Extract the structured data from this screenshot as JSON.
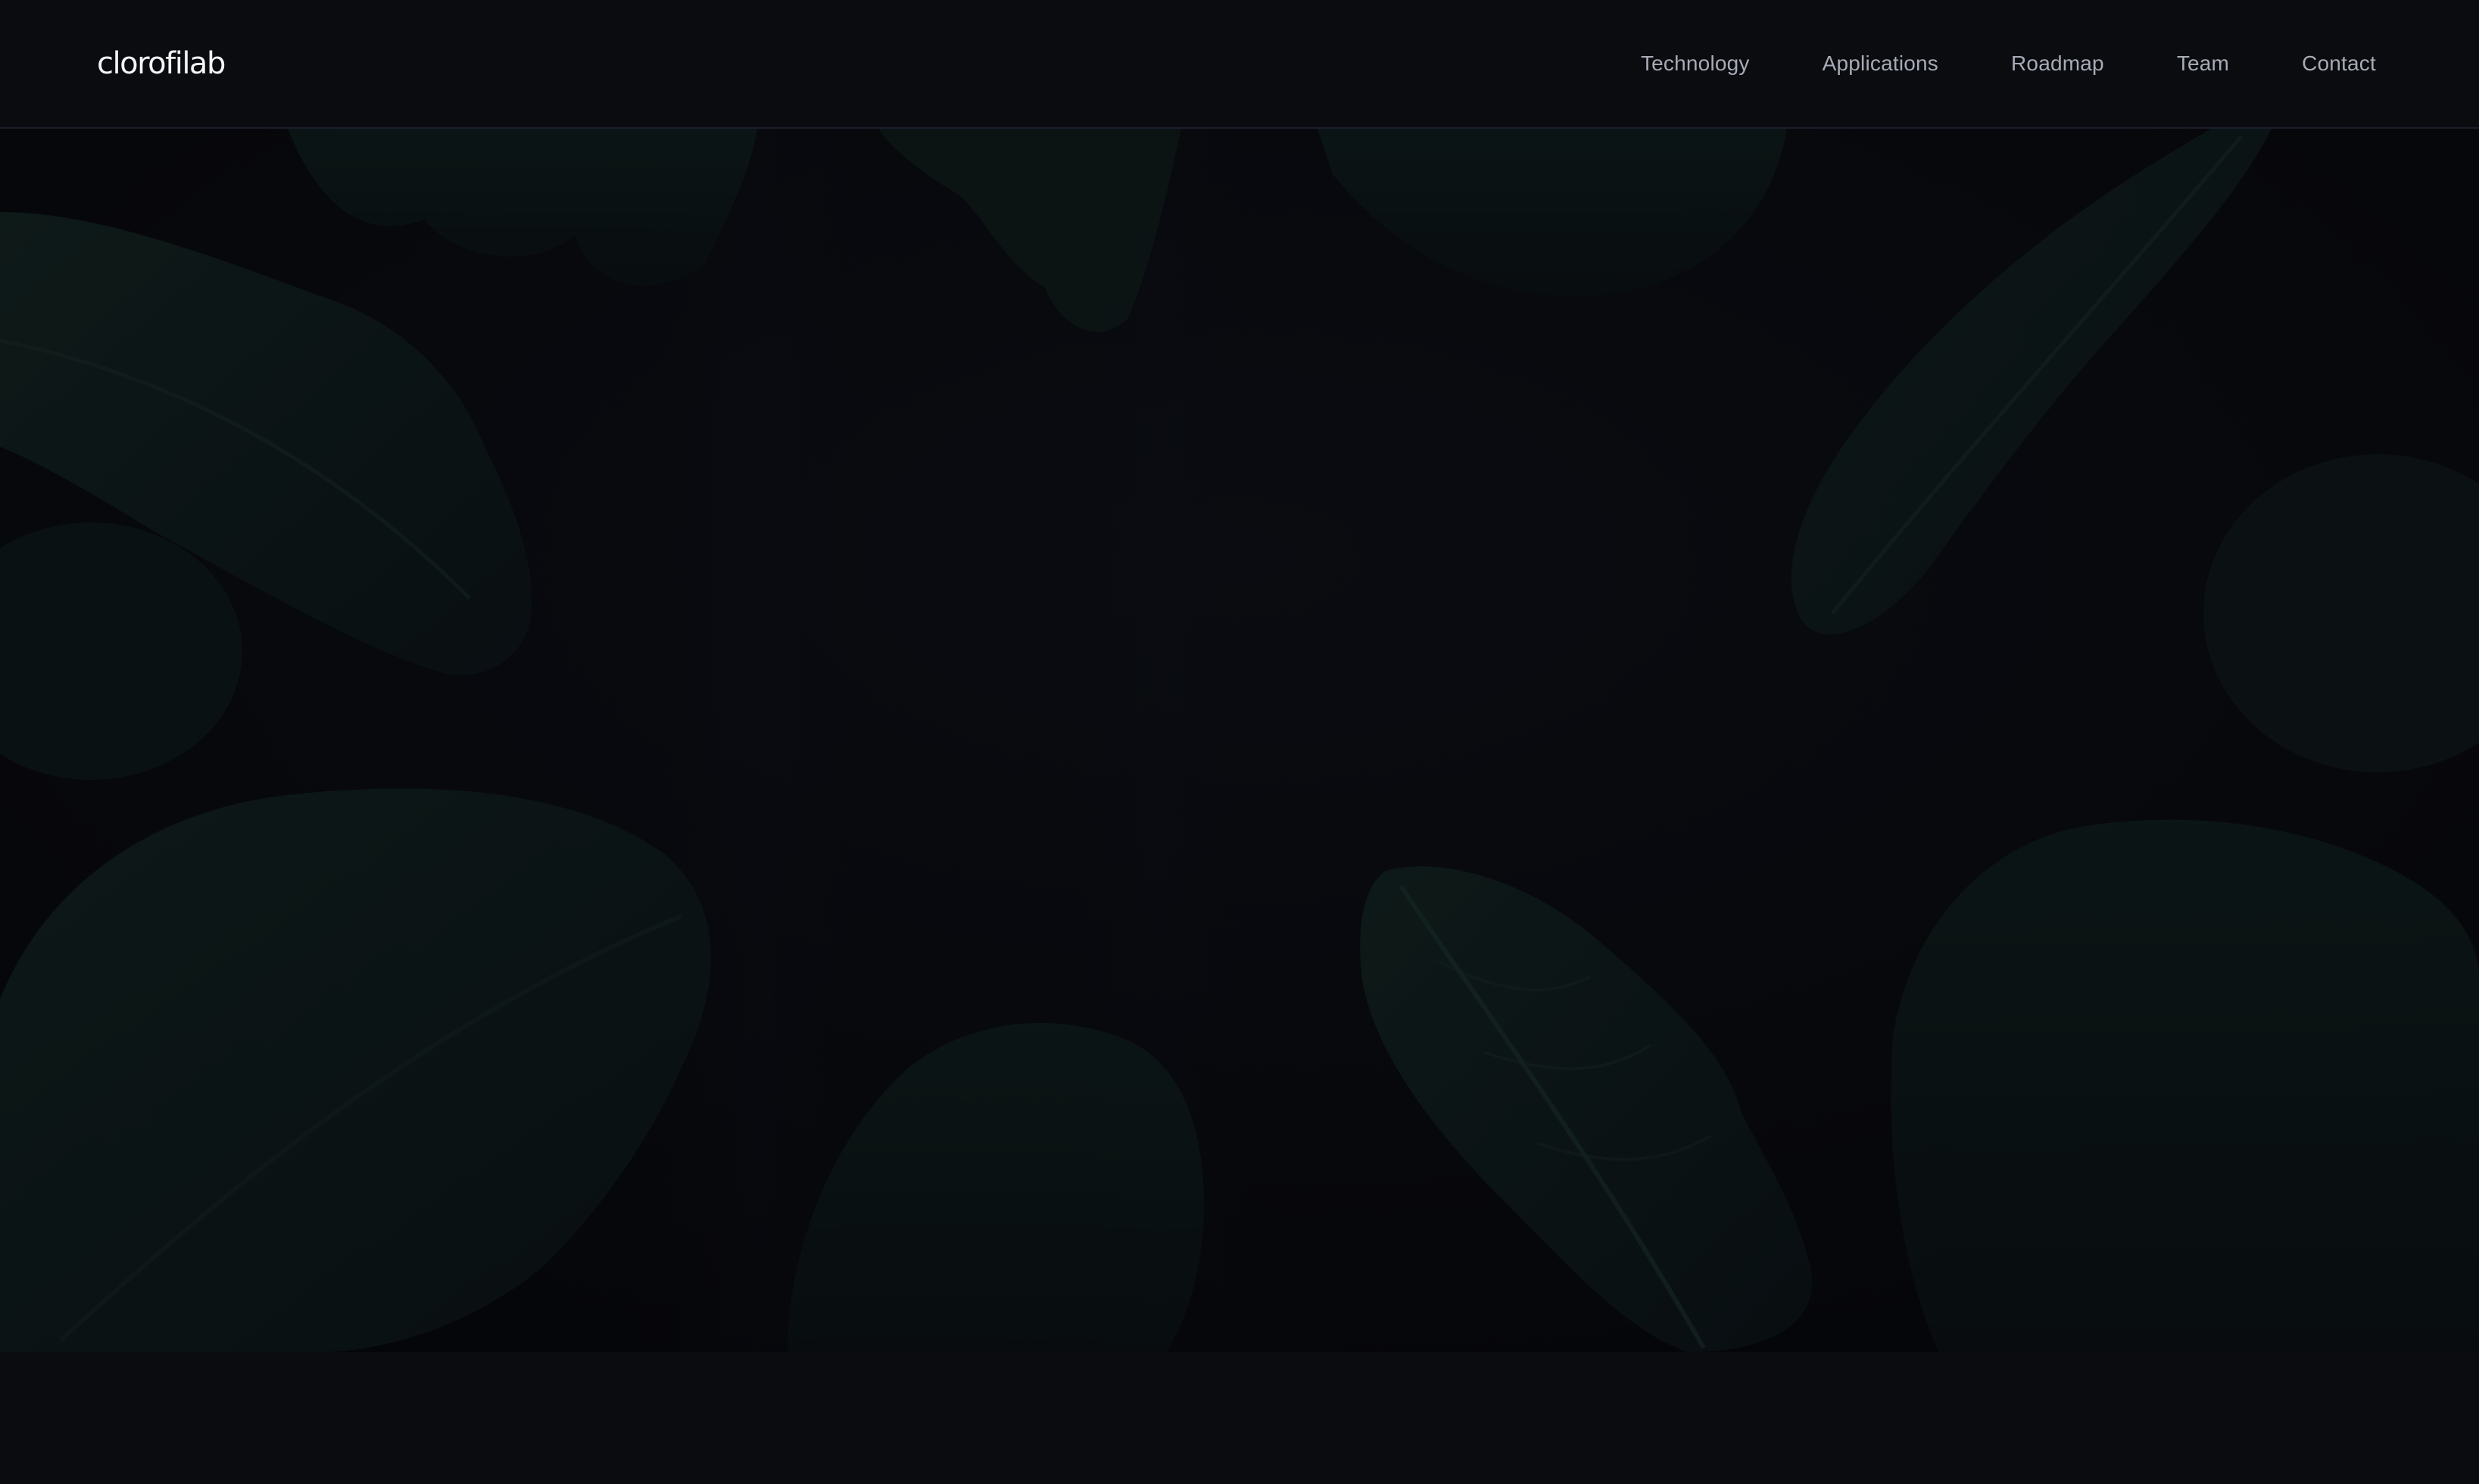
{
  "brand": {
    "logo_text": "clorofilab"
  },
  "nav": {
    "items": [
      {
        "label": "Technology"
      },
      {
        "label": "Applications"
      },
      {
        "label": "Roadmap"
      },
      {
        "label": "Team"
      },
      {
        "label": "Contact"
      }
    ]
  },
  "hero": {
    "background_image": "dark leafy greens (kale, lettuce, spinach leaves)"
  },
  "colors": {
    "page_background": "#0b0c10",
    "hero_background": "#07080b",
    "leaf_tint": "#122421",
    "nav_text": "#a7abb6",
    "logo_text": "#f2f3f5",
    "header_divider": "#1b1f2b"
  }
}
